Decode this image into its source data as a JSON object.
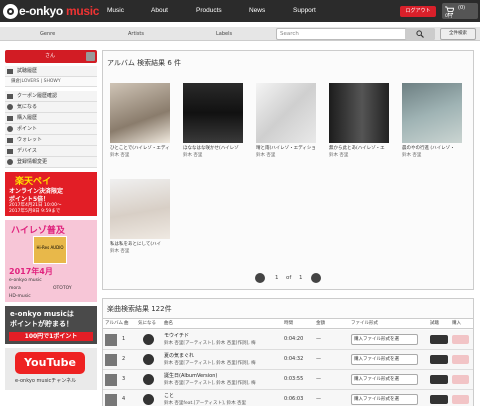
{
  "brand": {
    "name_prefix": "e-onkyo",
    "name_suffix": " music"
  },
  "nav": [
    "Music",
    "About",
    "Products",
    "News",
    "Support"
  ],
  "header": {
    "logout": "ログアウト",
    "cart_count": "(0)",
    "cart_yen": "0円"
  },
  "subnav": [
    "Genre",
    "Artists",
    "Labels"
  ],
  "search": {
    "placeholder": "Search",
    "all_search": "全件検索"
  },
  "sidebar": {
    "user": "さん",
    "trial": "試聴履歴",
    "trial_sub": "鎌倉|LOVERS | SHOWY",
    "items": [
      "クーポン履歴確認",
      "気になる",
      "購入履歴",
      "ポイント",
      "ウォレット",
      "デバイス",
      "登録情報変更"
    ]
  },
  "banners": {
    "rakuten": {
      "t1": "楽天ペイ",
      "t2": "オンライン決済限定",
      "t3": "ポイント5倍！",
      "t4": "2017年4月21日 10:00～",
      "t5": "2017年5月8日 9:59まで"
    },
    "hires": {
      "t1": "ハイレゾ普及",
      "badge": "Hi-Res AUDIO",
      "t2": "2017年4月",
      "t3": "e-onkyo music",
      "t4": "mora",
      "t5": "OTOTOY",
      "t6": "HD-music"
    },
    "points": {
      "t1": "e-onkyo musicは",
      "t2": "ポイントが貯まる！",
      "t3": "100円で1ポイント"
    },
    "youtube": {
      "logo": "YouTube",
      "t1": "e-onkyo musicチャンネル"
    }
  },
  "albums": {
    "heading": "アルバム 検索結果 6 件",
    "items": [
      {
        "title": "ひとことで(ハイレゾ・エディ",
        "artist": "鈴木 杏里"
      },
      {
        "title": "ほななはな咲かせ(ハイレゾ",
        "artist": "鈴木 杏里"
      },
      {
        "title": "晴と雨(ハイレゾ・エディション",
        "artist": "鈴木 杏里"
      },
      {
        "title": "無から此とあ(ハイレゾ・エ",
        "artist": "鈴木 杏里"
      },
      {
        "title": "晨のやの行進 (ハイレゾ・",
        "artist": "鈴木 杏里"
      },
      {
        "title": "私は私をあとにして(ハイ",
        "artist": "鈴木 杏里"
      }
    ],
    "pager": {
      "current": "1",
      "of": "of",
      "total": "1"
    }
  },
  "tracks": {
    "heading": "楽曲検索結果 122件",
    "columns": [
      "アルバム",
      "曲",
      "気になる",
      "曲名",
      "時間",
      "金額",
      "ファイル形式",
      "試聴",
      "購入"
    ],
    "rows": [
      {
        "num": "1",
        "title": "モウイチド",
        "artist": "鈴木 杏里[アーティスト], 鈴木 杏里[作詞], 梅",
        "time": "0:04:20",
        "price": "—",
        "format": "購入ファイル形式を選"
      },
      {
        "num": "2",
        "title": "夏の気まぐれ",
        "artist": "鈴木 杏里[アーティスト], 鈴木 杏里[作詞], 梅",
        "time": "0:04:32",
        "price": "—",
        "format": "購入ファイル形式を選"
      },
      {
        "num": "3",
        "title": "誕生日(AlbumVersion)",
        "artist": "鈴木 杏里[アーティスト], 鈴木 杏里[作詞], 梅",
        "time": "0:03:55",
        "price": "—",
        "format": "購入ファイル形式を選"
      },
      {
        "num": "4",
        "title": "こと",
        "artist": "鈴木 杏里feat.[アーティスト], 鈴木 杏里",
        "time": "0:06:03",
        "price": "—",
        "format": "購入ファイル形式を選"
      }
    ]
  },
  "colors": {
    "topbar": "#2b2b2b",
    "accent": "#d21c24"
  }
}
